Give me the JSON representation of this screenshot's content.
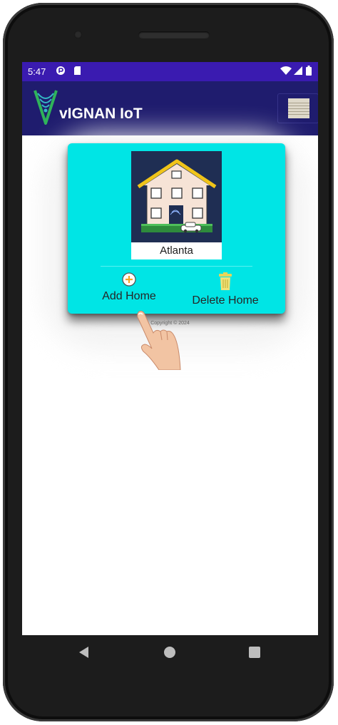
{
  "status_bar": {
    "time": "5:47",
    "color": "#3a1bb0"
  },
  "app_bar": {
    "title": "vIGNAN IoT",
    "color": "#1f1c6e",
    "logo_icon": "v-antenna-logo-icon",
    "menu_icon": "hamburger-menu-icon"
  },
  "card": {
    "color": "#00e5e5",
    "home": {
      "name": "Atlanta"
    },
    "actions": [
      {
        "label": "Add Home",
        "icon": "plus-circle-icon"
      },
      {
        "label": "Delete Home",
        "icon": "trash-icon"
      }
    ]
  },
  "footer": {
    "copyright": "Copyright © 2024"
  }
}
